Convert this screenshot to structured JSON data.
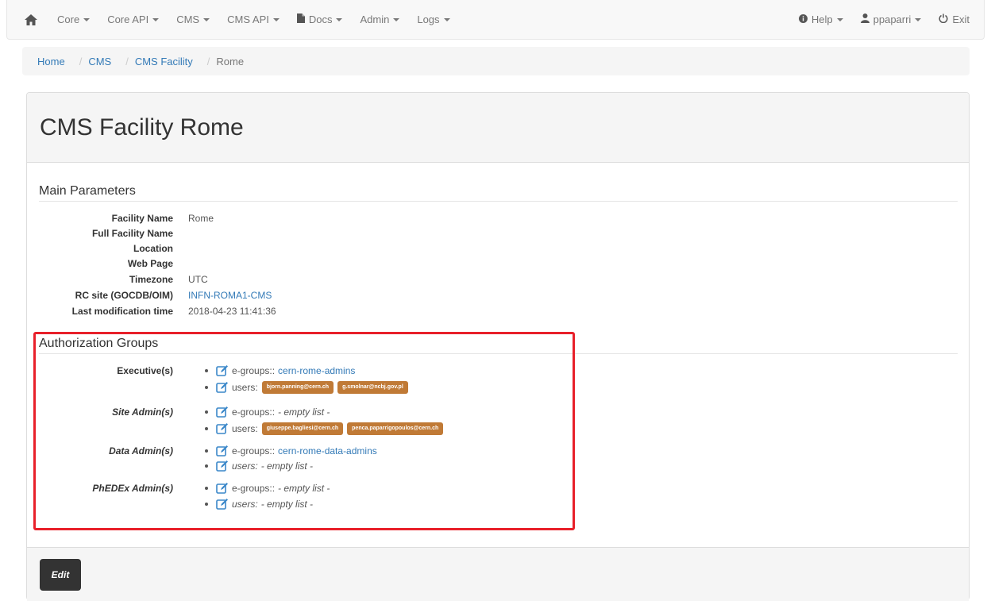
{
  "navbar": {
    "left": [
      {
        "label": "Core",
        "icon": ""
      },
      {
        "label": "Core API",
        "icon": ""
      },
      {
        "label": "CMS",
        "icon": ""
      },
      {
        "label": "CMS API",
        "icon": ""
      },
      {
        "label": "Docs",
        "icon": "file-icon"
      },
      {
        "label": "Admin",
        "icon": ""
      },
      {
        "label": "Logs",
        "icon": ""
      }
    ],
    "right": [
      {
        "label": "Help",
        "icon": "info-circle-icon"
      },
      {
        "label": "ppaparri",
        "icon": "user-icon"
      },
      {
        "label": "Exit",
        "icon": "power-icon"
      }
    ]
  },
  "breadcrumb": {
    "home": "Home",
    "cms": "CMS",
    "facility": "CMS Facility",
    "current": "Rome",
    "sep": "/"
  },
  "page": {
    "title": "CMS Facility Rome",
    "edit_label": "Edit"
  },
  "main_parameters": {
    "title": "Main Parameters",
    "rows": [
      {
        "label": "Facility Name",
        "value": "Rome"
      },
      {
        "label": "Full Facility Name",
        "value": ""
      },
      {
        "label": "Location",
        "value": ""
      },
      {
        "label": "Web Page",
        "value": ""
      },
      {
        "label": "Timezone",
        "value": "UTC"
      },
      {
        "label": "RC site (GOCDB/OIM)",
        "value": "INFN-ROMA1-CMS"
      },
      {
        "label": "Last modification time",
        "value": "2018-04-23 11:41:36"
      }
    ]
  },
  "authorization_groups": {
    "title": "Authorization Groups",
    "egroups_label": "e-groups::",
    "users_label": "users:",
    "empty_label": "- empty list -",
    "groups": [
      {
        "label": "Executive(s)",
        "egroup": "cern-rome-admins",
        "users": [
          "bjorn.panning@cern.ch",
          "g.smolnar@ncbj.gov.pl"
        ]
      },
      {
        "label": "Site Admin(s)",
        "egroup": "",
        "users": [
          "giuseppe.bagliesi@cern.ch",
          "penca.paparrigopoulos@cern.ch"
        ]
      },
      {
        "label": "Data Admin(s)",
        "egroup": "cern-rome-data-admins",
        "users": []
      },
      {
        "label": "PhEDEx Admin(s)",
        "egroup": "",
        "users": []
      }
    ]
  },
  "colors": {
    "link": "#337ab7",
    "tag": "#c07a36",
    "highlight": "#e8202a"
  }
}
